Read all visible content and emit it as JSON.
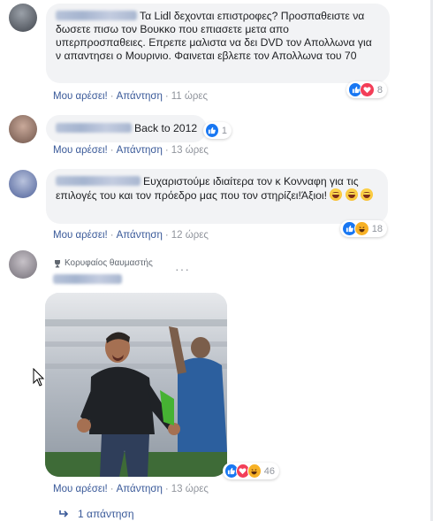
{
  "labels": {
    "like": "Μου αρέσει!",
    "reply": "Απάντηση",
    "separator": "·"
  },
  "comments": [
    {
      "text": "Τα Lidl δεχονται επιστροφες? Προσπαθειστε να δωσετε πισω τον Βουκκο που επιασετε μετα απο υπερπροσπαθειες. Επρεπε μαλιστα να δει DVD τον Απολλωνα για ν απαντησει ο Μουρινιο. Φαινεται εβλεπε τον Απολλωνα του 70",
      "time": "11 ώρες",
      "reaction_count": "8",
      "reactions": [
        "like-icon",
        "love-icon"
      ]
    },
    {
      "text": "Back to 2012",
      "time": "13 ώρες",
      "reaction_count": "1",
      "reactions": [
        "like-icon"
      ]
    },
    {
      "text": "Ευχαριστούμε ιδιαίτερα τον κ Κονναφη για τις επιλογές του και τον πρόεδρο μας που τον στηρίζει!Άξιοι!",
      "time": "12 ώρες",
      "reaction_count": "18",
      "reactions": [
        "like-icon",
        "haha-icon"
      ]
    },
    {
      "badge": "Κορυφαίος θαυμαστής",
      "time": "13 ώρες",
      "reaction_count": "46",
      "reactions": [
        "like-icon",
        "love-icon",
        "haha-icon"
      ]
    }
  ],
  "replies": {
    "label": "1 απάντηση"
  },
  "colors": {
    "bubble": "#f2f3f5",
    "link": "#385898",
    "meta": "#90949c",
    "like_blue": "#1877f2",
    "love_red": "#f33e58",
    "haha_yellow": "#f7b125"
  }
}
